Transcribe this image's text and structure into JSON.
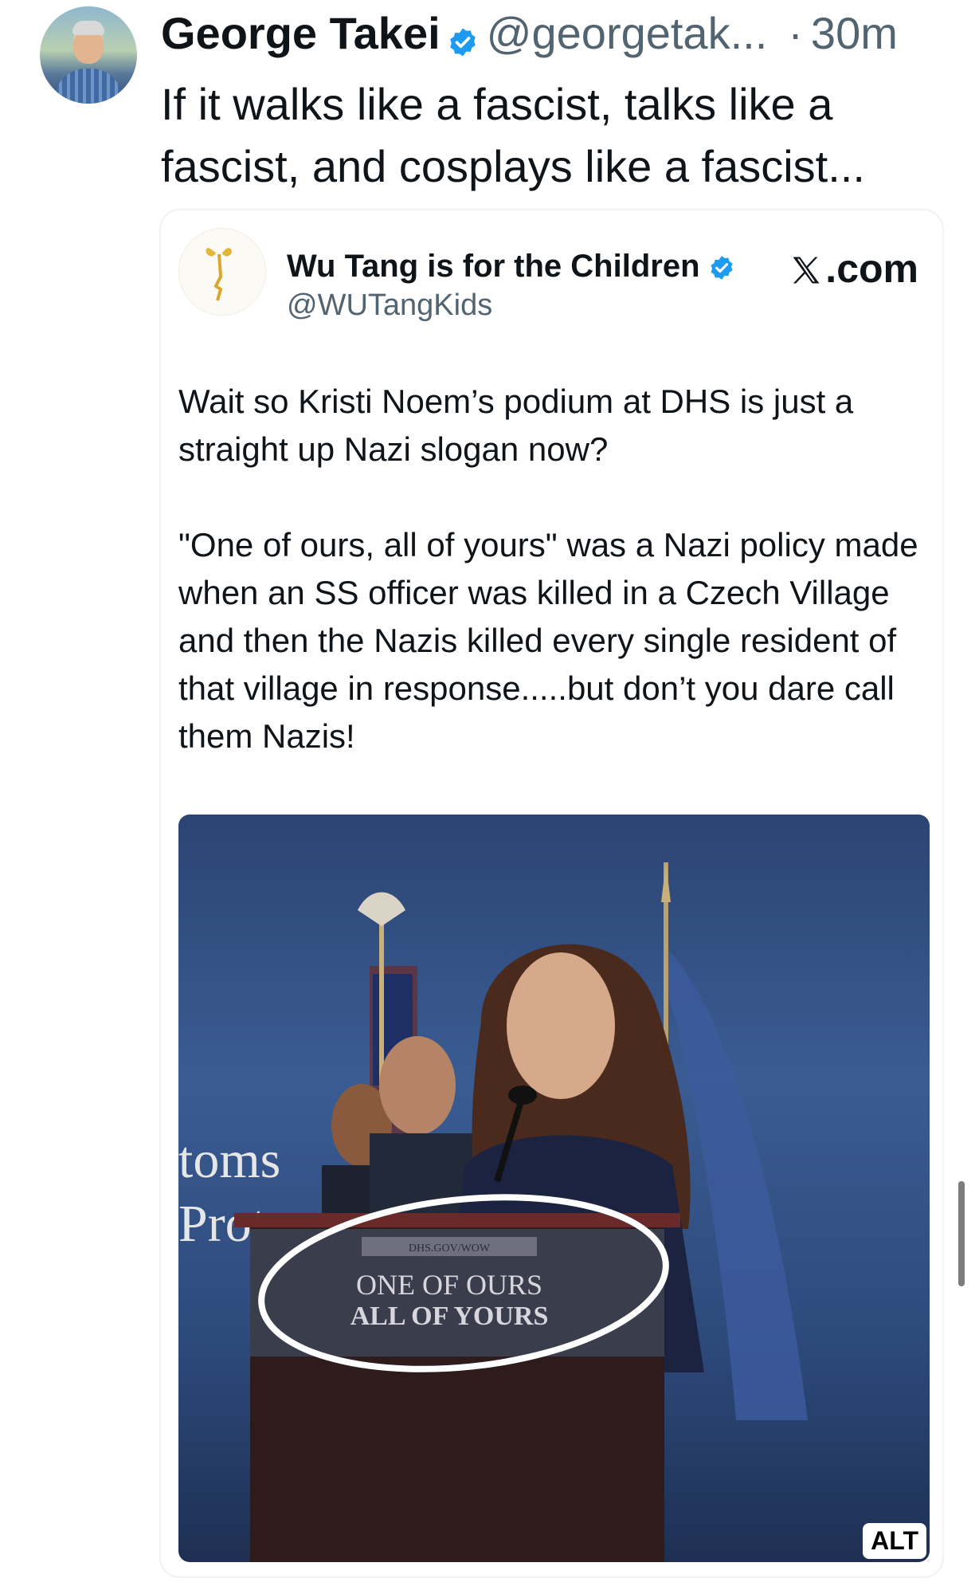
{
  "post": {
    "display_name": "George Takei",
    "handle": "@georgetak...",
    "dot": "·",
    "time": "30m",
    "text": "If it walks like a fascist, talks like a fascist, and cosplays like a fascist..."
  },
  "embed": {
    "display_name": "Wu Tang is for the Children",
    "handle": "@WUTangKids",
    "source": ".com",
    "paragraphs": [
      "Wait so Kristi Noem’s podium at DHS is just a straight up Nazi slogan now?",
      "\"One of ours, all of yours\" was a Nazi policy made when an SS officer was killed in a Czech Village and then the Nazis killed every single resident of that village in response.....but don’t you dare call them Nazis!"
    ],
    "photo": {
      "background_sign": "toms",
      "background_sign_2": "Prot",
      "podium_url": "DHS.GOV/WOW",
      "podium_line1": "ONE OF OURS",
      "podium_line2": "ALL OF YOURS",
      "alt_label": "ALT"
    }
  },
  "icons": {
    "verified": "verified-badge-icon",
    "x_logo": "x-logo-icon"
  },
  "colors": {
    "verified_blue": "#1d9bf0",
    "secondary_text": "#536471",
    "primary_text": "#0f1419"
  }
}
